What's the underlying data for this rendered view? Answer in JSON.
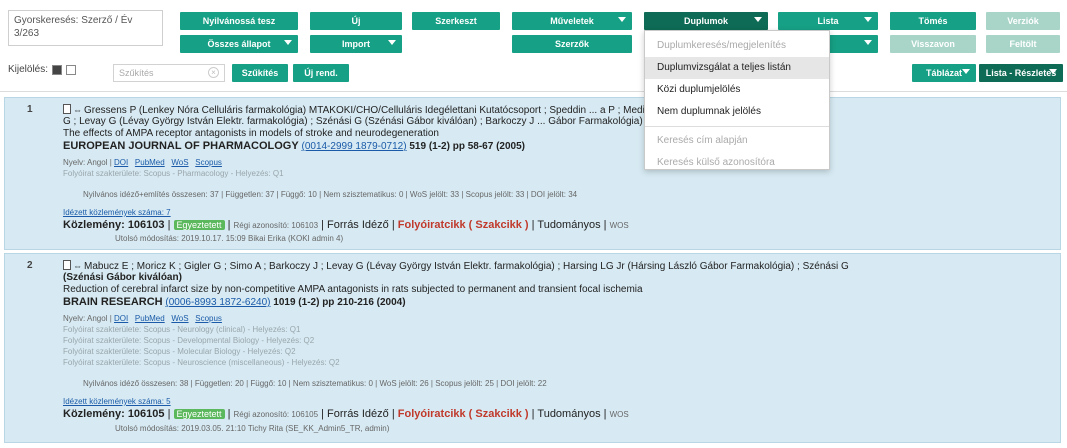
{
  "toolbar": {
    "gyorskereses": "Gyorskeresés: Szerző / Év",
    "count": "3/263",
    "buttons": {
      "nyilvanossa_teszi": "Nyilvánossá tesz",
      "osszes_allapot": "Összes állapot",
      "uj": "Új",
      "import": "Import",
      "szerkeszt": "Szerkeszt",
      "muveletek": "Műveletek",
      "szerzok": "Szerzők",
      "duplumok": "Duplumok",
      "lista": "Lista",
      "tobb": "",
      "tomeg": "Tömés",
      "visszavon": "Visszavon",
      "verzio": "Verziók",
      "feltolt": "Feltölt",
      "tablazat": "Táblázat",
      "lista_reszletes": "Lista - Részletes"
    },
    "kijeloles": "Kijelölés:",
    "szukites_placeholder": "Szűkítés",
    "szukites_btn": "Szűkítés",
    "uj_rend": "Új rend."
  },
  "dropdown": {
    "items": [
      "Duplumkeresés/megjelenítés",
      "Duplumvizsgálat a teljes listán",
      "Közi duplumjelölés",
      "Nem duplumnak jelölés",
      "Keresés cím alapján",
      "Keresés külső azonosítóra"
    ]
  },
  "records": [
    {
      "num": "1",
      "authors": "Gressens P (Lenkey Nóra Celluláris farmakológia) MTAKOKI/CHO/Celluláris Idegélettani Kutatócsoport ;  Speddin  ...  a P ;  Media F ;  Williamson T ;  Kapus",
      "authors2": "G ;  Levay G (Lévay György István Elektr. farmakológia) ;  Szénási G (Szénási Gábor kiválóan) ;  Barkoczy J  ...  Gábor Farmakológia)",
      "title": "The effects of AMPA receptor antagonists in models of stroke and neurodegeneration",
      "journal": "EUROPEAN JOURNAL OF PHARMACOLOGY",
      "issn": "(0014-2999 1879-0712)",
      "vol": "519 (1-2) pp 58-67 (2005)",
      "links": [
        "Nyelv: Angol",
        "DOI",
        "PubMed",
        "WoS",
        "Scopus"
      ],
      "faint": [
        "Folyóirat szakterülete: Scopus - Pharmacology - Helyezés: Q1"
      ],
      "citations": "Nyilvános idéző+említés összesen: 37 | Független: 37 | Függő: 10 | Nem szisztematikus: 0 | WoS jelölt: 33 | Scopus jelölt: 33 | DOI jelölt: 34",
      "cite_link": "Idézett közlemények száma: 7",
      "kozlemeny_label": "Közlemény:",
      "kozlemeny_id": "106103",
      "badge": "Egyeztetett",
      "regi": "Régi azonosító: 106103",
      "forras": "Forrás Idéző",
      "red": "Folyóiratcikk ( Szakcikk )",
      "tudomanyos": "Tudományos",
      "wos": "WOS",
      "modositas": "Utolsó módosítás: 2019.10.17. 15:09 Bikai Erika (KOKI admin 4)"
    },
    {
      "num": "2",
      "authors": "Mabucz E ;  Moricz K ;  Gigler G ;  Simo A ;  Barkoczy J ;  Levay G (Lévay György István Elektr. farmakológia) ;  Harsing LG Jr (Hársing László Gábor Farmakológia) ;  Szénási G",
      "authors2": "(Szénási Gábor kiválóan)",
      "title": "Reduction of cerebral infarct size by non-competitive AMPA antagonists in rats subjected to permanent and transient focal ischemia",
      "journal": "BRAIN RESEARCH",
      "issn": "(0006-8993 1872-6240)",
      "vol": "1019 (1-2) pp 210-216 (2004)",
      "links": [
        "Nyelv: Angol",
        "DOI",
        "PubMed",
        "WoS",
        "Scopus"
      ],
      "faint": [
        "Folyóirat szakterülete: Scopus - Neurology (clinical) - Helyezés: Q1",
        "Folyóirat szakterülete: Scopus - Developmental Biology - Helyezés: Q2",
        "Folyóirat szakterülete: Scopus - Molecular Biology - Helyezés: Q2",
        "Folyóirat szakterülete: Scopus - Neuroscience (miscellaneous) - Helyezés: Q2"
      ],
      "citations": "Nyilvános idéző összesen: 38 | Független: 20 | Függő: 10 | Nem szisztematikus: 0 | WoS jelölt: 26 | Scopus jelölt: 25 | DOI jelölt: 22",
      "cite_link": "Idézett közlemények száma: 5",
      "kozlemeny_label": "Közlemény:",
      "kozlemeny_id": "106105",
      "badge": "Egyeztetett",
      "regi": "Régi azonosító: 106105",
      "forras": "Forrás Idéző",
      "red": "Folyóiratcikk ( Szakcikk )",
      "tudomanyos": "Tudományos",
      "wos": "WOS",
      "modositas": "Utolsó módosítás: 2019.03.05. 21:10 Tichy Rita (SE_KK_Admin5_TR, admin)"
    }
  ]
}
